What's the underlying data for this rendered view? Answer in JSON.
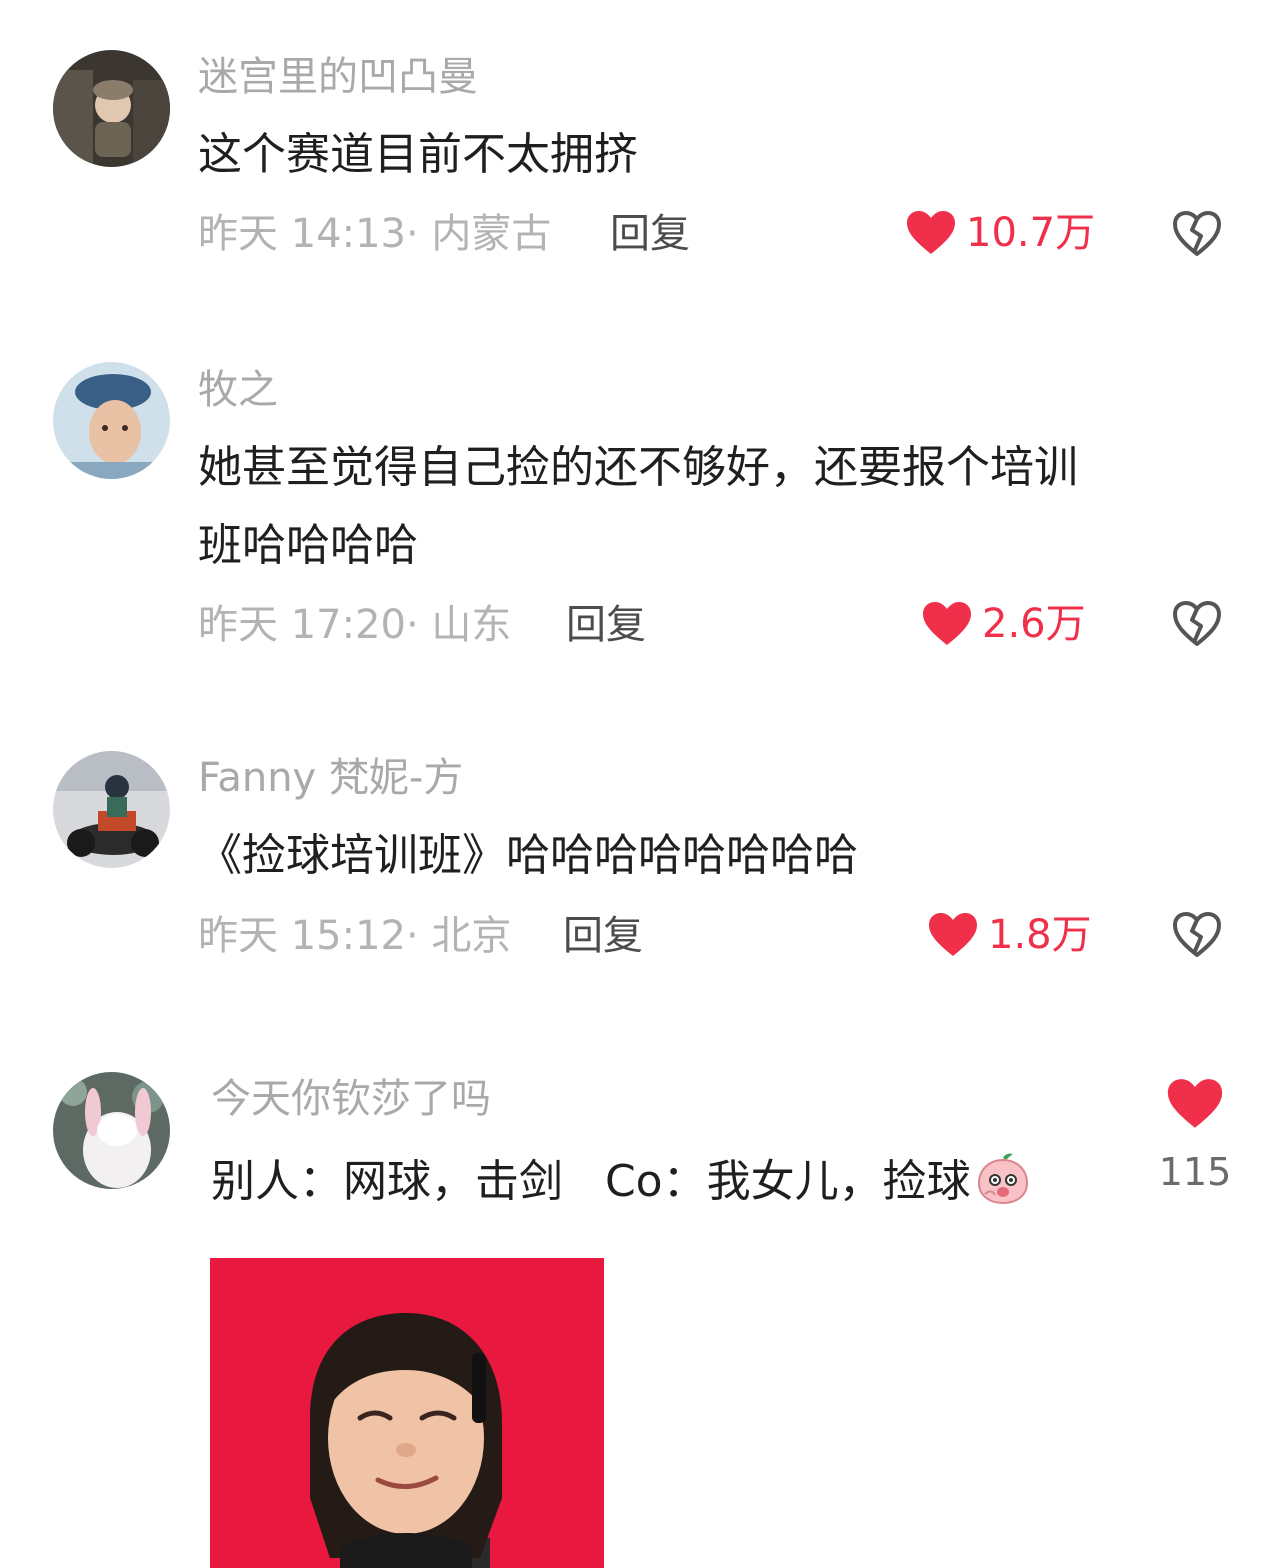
{
  "comments": [
    {
      "username": "迷宫里的凹凸曼",
      "text": "这个赛道目前不太拥挤",
      "meta": "昨天 14:13· 内蒙古",
      "reply": "回复",
      "likes": "10.7万"
    },
    {
      "username": "牧之",
      "text_line1": "她甚至觉得自己捡的还不够好，还要报个培训",
      "text_line2": "班哈哈哈哈",
      "meta": "昨天 17:20· 山东",
      "reply": "回复",
      "likes": "2.6万"
    },
    {
      "username": "Fanny 梵妮-方",
      "text": "《捡球培训班》哈哈哈哈哈哈哈哈",
      "meta": "昨天 15:12· 北京",
      "reply": "回复",
      "likes": "1.8万"
    },
    {
      "username": "今天你钦莎了吗",
      "text": "别人：网球，击剑   Co：我女儿，捡球",
      "likes": "115"
    }
  ],
  "colors": {
    "like_red": "#f0304a",
    "username_gray": "#a9a9a9",
    "meta_gray": "#b3b3b3",
    "body_text": "#1f1f1f"
  },
  "icons": {
    "like": "heart-icon",
    "dislike": "broken-heart-icon",
    "emoji": "peach-emoji-icon"
  }
}
